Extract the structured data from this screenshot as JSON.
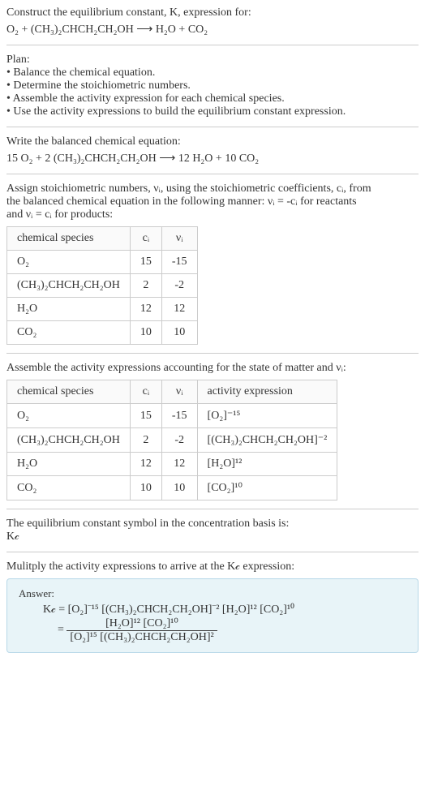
{
  "intro": {
    "line1": "Construct the equilibrium constant, K, expression for:",
    "equation": "O₂ + (CH₃)₂CHCH₂CH₂OH  ⟶  H₂O + CO₂"
  },
  "plan": {
    "heading": "Plan:",
    "items": [
      "• Balance the chemical equation.",
      "• Determine the stoichiometric numbers.",
      "• Assemble the activity expression for each chemical species.",
      "• Use the activity expressions to build the equilibrium constant expression."
    ]
  },
  "balanced": {
    "heading": "Write the balanced chemical equation:",
    "equation": "15 O₂ + 2 (CH₃)₂CHCH₂CH₂OH  ⟶  12 H₂O + 10 CO₂"
  },
  "stoich": {
    "heading_a": "Assign stoichiometric numbers, νᵢ, using the stoichiometric coefficients, cᵢ, from",
    "heading_b": "the balanced chemical equation in the following manner: νᵢ = -cᵢ for reactants",
    "heading_c": "and νᵢ = cᵢ for products:",
    "headers": [
      "chemical species",
      "cᵢ",
      "νᵢ"
    ],
    "rows": [
      [
        "O₂",
        "15",
        "-15"
      ],
      [
        "(CH₃)₂CHCH₂CH₂OH",
        "2",
        "-2"
      ],
      [
        "H₂O",
        "12",
        "12"
      ],
      [
        "CO₂",
        "10",
        "10"
      ]
    ]
  },
  "activity": {
    "heading": "Assemble the activity expressions accounting for the state of matter and νᵢ:",
    "headers": [
      "chemical species",
      "cᵢ",
      "νᵢ",
      "activity expression"
    ],
    "rows": [
      [
        "O₂",
        "15",
        "-15",
        "[O₂]⁻¹⁵"
      ],
      [
        "(CH₃)₂CHCH₂CH₂OH",
        "2",
        "-2",
        "[(CH₃)₂CHCH₂CH₂OH]⁻²"
      ],
      [
        "H₂O",
        "12",
        "12",
        "[H₂O]¹²"
      ],
      [
        "CO₂",
        "10",
        "10",
        "[CO₂]¹⁰"
      ]
    ]
  },
  "symbol": {
    "line1": "The equilibrium constant symbol in the concentration basis is:",
    "line2": "K𝒸"
  },
  "final": {
    "heading": "Mulitply the activity expressions to arrive at the K𝒸 expression:",
    "answer_label": "Answer:",
    "expr_line1": "K𝒸 = [O₂]⁻¹⁵ [(CH₃)₂CHCH₂CH₂OH]⁻² [H₂O]¹² [CO₂]¹⁰",
    "frac_num": "[H₂O]¹² [CO₂]¹⁰",
    "frac_den": "[O₂]¹⁵ [(CH₃)₂CHCH₂CH₂OH]²",
    "eq_prefix": "= "
  }
}
